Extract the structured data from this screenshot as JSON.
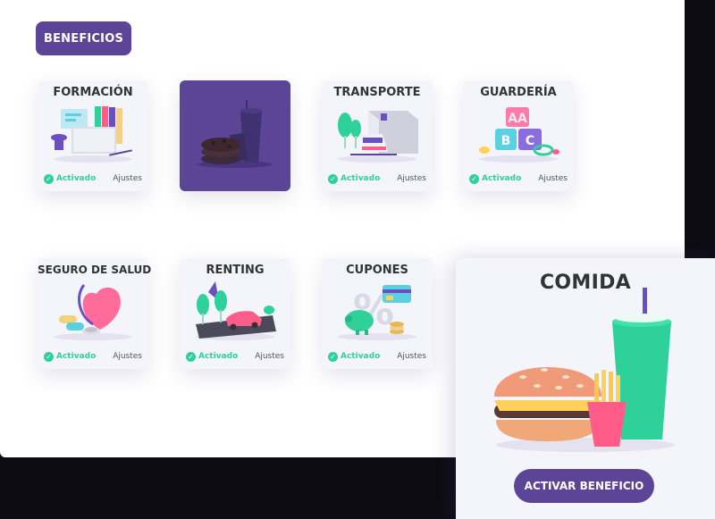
{
  "header": {
    "tag": "BENEFICIOS"
  },
  "cards": [
    {
      "title": "FORMACIÓN",
      "status": "Activado",
      "settings": "Ajustes"
    },
    {
      "selected": true
    },
    {
      "title": "TRANSPORTE",
      "status": "Activado",
      "settings": "Ajustes"
    },
    {
      "title": "GUARDERÍA",
      "status": "Activado",
      "settings": "Ajustes"
    },
    {
      "title": "SEGURO DE SALUD",
      "status": "Activado",
      "settings": "Ajustes"
    },
    {
      "title": "RENTING",
      "status": "Activado",
      "settings": "Ajustes"
    },
    {
      "title": "CUPONES",
      "status": "Activado",
      "settings": "Ajustes"
    }
  ],
  "detail": {
    "title": "COMIDA",
    "button": "ACTIVAR BENEFICIO"
  },
  "colors": {
    "primary": "#5c4596",
    "active": "#2ed19a",
    "card_bg": "#f4f5fb",
    "backdrop": "#0d0c14"
  },
  "icons": [
    "check-circle-icon",
    "books-icon",
    "cookie-cup-icon",
    "train-icon",
    "toy-blocks-icon",
    "heart-stethoscope-icon",
    "car-icon",
    "piggy-bank-icon",
    "burger-drink-icon"
  ]
}
